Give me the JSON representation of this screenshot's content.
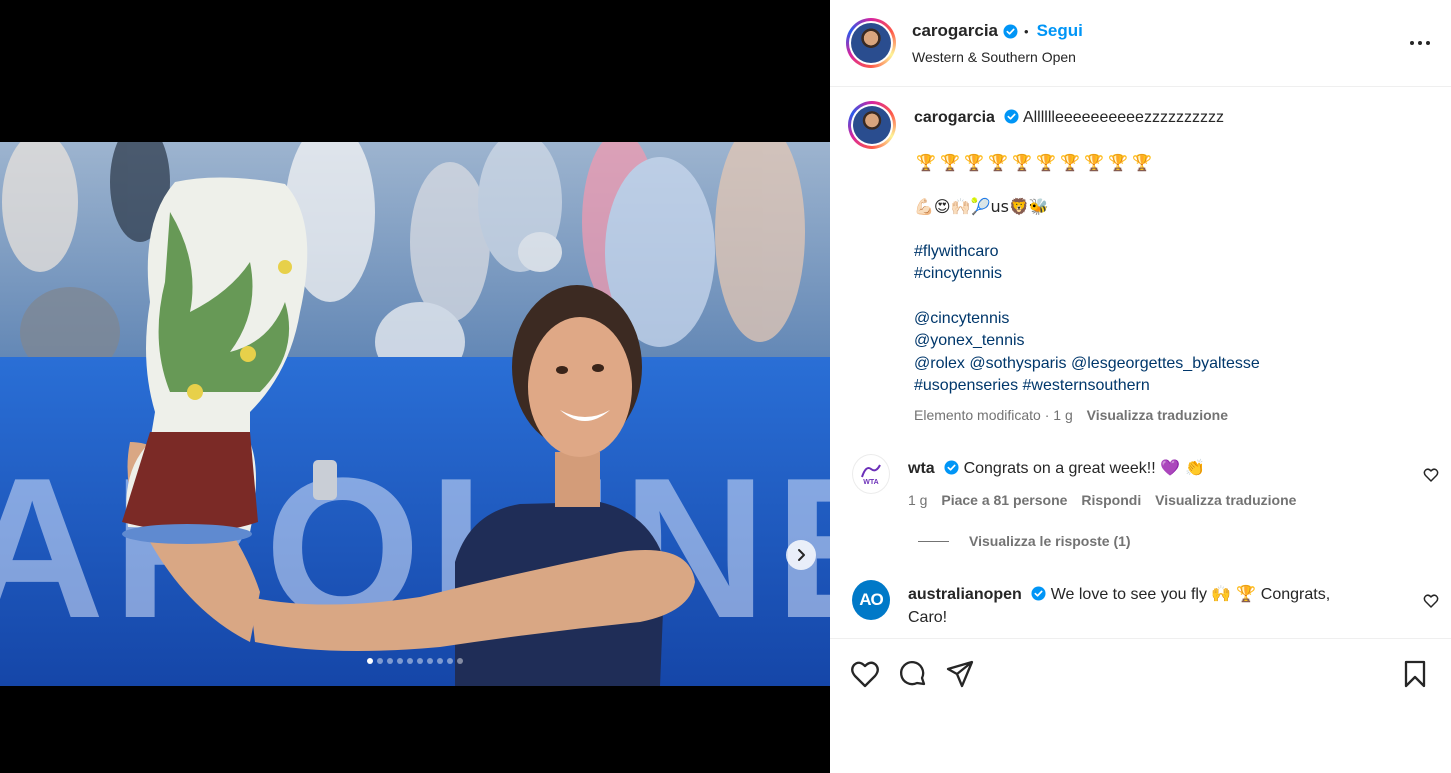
{
  "header": {
    "username": "carogarcia",
    "separator": "•",
    "follow_label": "Segui",
    "location": "Western & Southern Open"
  },
  "caption": {
    "username": "carogarcia",
    "text": "Alllllleeeeeeeeeezzzzzzzzzz",
    "trophy_line": "🏆🏆🏆🏆🏆🏆🏆🏆🏆🏆",
    "emoji_line_prefix": "💪🏻😍🙌🏻🎾",
    "emoji_line_us": "us",
    "emoji_line_suffix": "🦁🐝",
    "hashtags": [
      "#flywithcaro",
      "#cincytennis"
    ],
    "mentions_line1": "@cincytennis",
    "mentions_line2": "@yonex_tennis",
    "mentions_line3": [
      "@rolex",
      "@sothysparis",
      "@lesgeorgettes_byaltesse"
    ],
    "hashtags_line4": [
      "#usopenseries",
      "#westernsouthern"
    ],
    "meta_edited": "Elemento modificato · 1 g",
    "meta_translate": "Visualizza traduzione"
  },
  "comments": [
    {
      "username": "wta",
      "logo_text": "WTA",
      "text": "Congrats on a great week!!",
      "emoji": "💜 👏",
      "time": "1 g",
      "likes": "Piace a 81 persone",
      "reply": "Rispondi",
      "translate": "Visualizza traduzione",
      "view_replies": "Visualizza le risposte (1)"
    },
    {
      "username": "australianopen",
      "logo_text": "AO",
      "text_before": "We love to see you fly",
      "emoji": "🙌 🏆",
      "text_after": "Congrats,",
      "text_line2": "Caro!"
    }
  ],
  "carousel": {
    "total": 10,
    "active": 1
  },
  "icons": [
    "verified-badge-icon",
    "more-options-icon",
    "next-arrow-icon",
    "heart-icon",
    "comment-icon",
    "share-icon",
    "bookmark-icon"
  ],
  "colors": {
    "accent": "#0095f6",
    "verified": "#0095f6",
    "link": "#00376b",
    "muted": "#737373"
  }
}
